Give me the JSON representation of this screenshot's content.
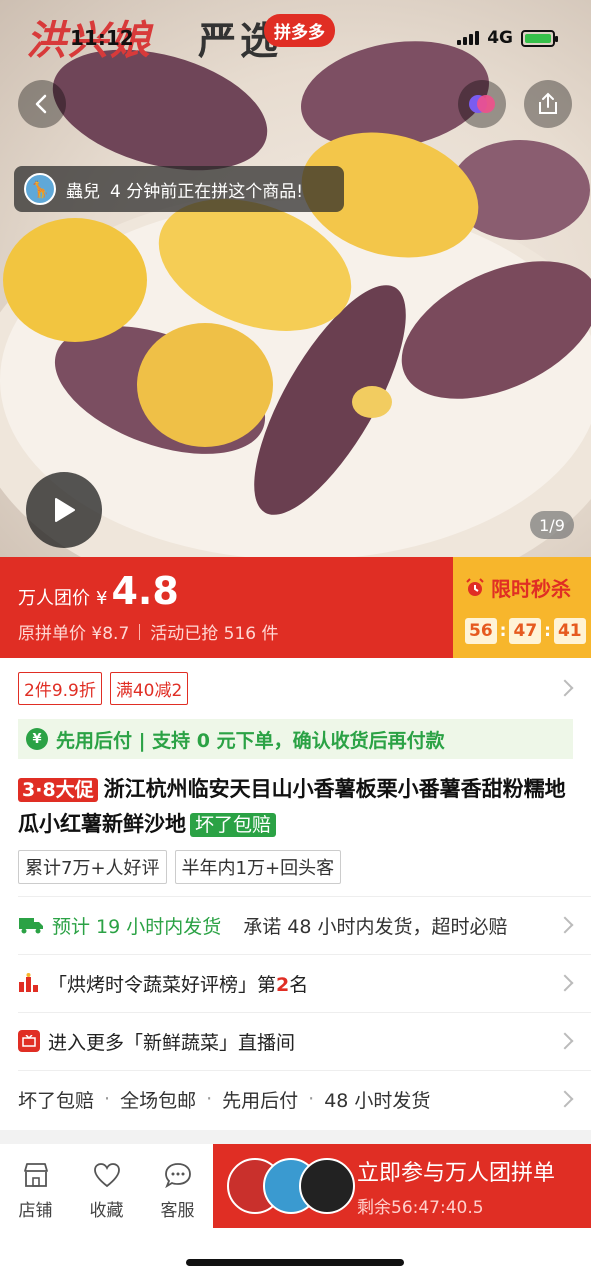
{
  "status": {
    "time": "11:12",
    "network": "4G"
  },
  "brand": {
    "name": "洪兴娘",
    "sub": "严选",
    "platform": "拼多多"
  },
  "toast": {
    "user": "蟲兒",
    "text": "4 分钟前正在拼这个商品!"
  },
  "gallery": {
    "page": "1/9"
  },
  "price": {
    "label": "万人团价",
    "currency": "¥",
    "value": "4.8",
    "original": "原拼单价 ¥8.7",
    "sold": "活动已抢 516 件"
  },
  "flash": {
    "title": "限时秒杀",
    "hh": "56",
    "mm": "47",
    "ss": "41"
  },
  "promos": [
    "2件9.9折",
    "满40减2"
  ],
  "paylater": {
    "text": "先用后付 | 支持 0 元下单，确认收货后再付款"
  },
  "product": {
    "badge": "3·8大促",
    "title": "浙江杭州临安天目山小香薯板栗小番薯香甜粉糯地瓜小红薯新鲜沙地",
    "guarantee": "坏了包赔"
  },
  "reviews": [
    "累计7万+人好评",
    "半年内1万+回头客"
  ],
  "shipping": {
    "estimate": "预计 19 小时内发货",
    "promise": "承诺 48 小时内发货，超时必赔"
  },
  "rank": {
    "prefix": "「烘烤时令蔬菜好评榜」第",
    "num": "2",
    "suffix": "名"
  },
  "live": {
    "text": "进入更多「新鲜蔬菜」直播间"
  },
  "services": [
    "坏了包赔",
    "全场包邮",
    "先用后付",
    "48 小时发货"
  ],
  "bottom": {
    "store": "店铺",
    "fav": "收藏",
    "service": "客服",
    "cta": "立即参与万人团拼单",
    "remaining": "剩余56:47:40.5"
  },
  "colors": {
    "accent": "#e02e24",
    "flash_bg": "#f7b62c",
    "green": "#2ba245"
  }
}
